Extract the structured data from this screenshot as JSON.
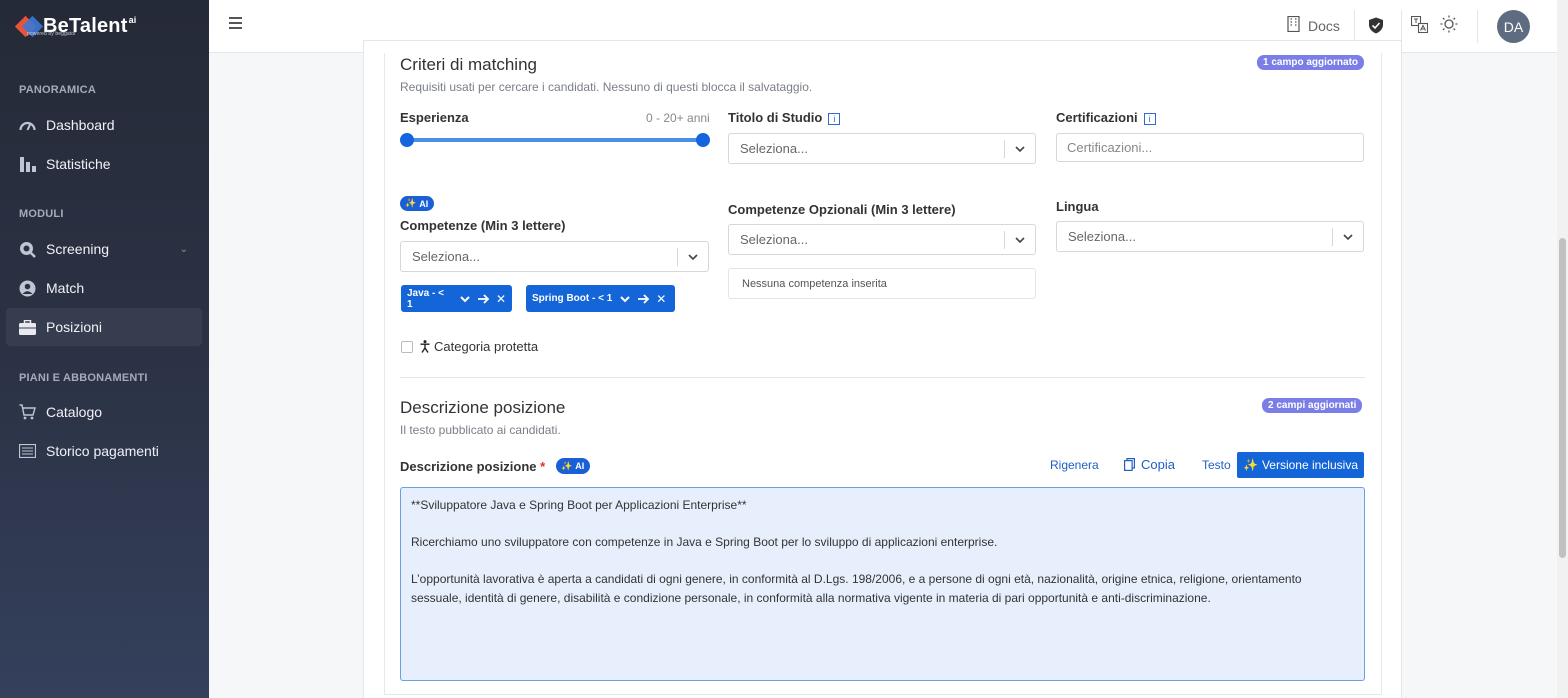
{
  "sidebar": {
    "brand": "BeTalent",
    "brand_suffix": "ai",
    "brand_tagline": "powered by beggator",
    "sections": [
      {
        "title": "PANORAMICA",
        "items": [
          {
            "label": "Dashboard",
            "icon": "gauge-icon"
          },
          {
            "label": "Statistiche",
            "icon": "bar-chart-icon"
          }
        ]
      },
      {
        "title": "MODULI",
        "items": [
          {
            "label": "Screening",
            "icon": "search-icon"
          },
          {
            "label": "Match",
            "icon": "user-circle-icon"
          },
          {
            "label": "Posizioni",
            "icon": "briefcase-icon",
            "active": true
          }
        ]
      },
      {
        "title": "PIANI E ABBONAMENTI",
        "items": [
          {
            "label": "Catalogo",
            "icon": "cart-icon"
          },
          {
            "label": "Storico pagamenti",
            "icon": "list-icon"
          }
        ]
      }
    ]
  },
  "header": {
    "docs_label": "Docs",
    "avatar_initials": "DA"
  },
  "matching": {
    "title": "Criteri di matching",
    "subtitle": "Requisiti usati per cercare i candidati. Nessuno di questi blocca il salvataggio.",
    "badge": "1 campo aggiornato",
    "experience": {
      "label": "Esperienza",
      "range_text": "0 - 20+ anni",
      "min": 0,
      "max": 20
    },
    "titolo_studio": {
      "label": "Titolo di Studio",
      "placeholder": "Seleziona..."
    },
    "certificazioni": {
      "label": "Certificazioni",
      "placeholder": "Certificazioni..."
    },
    "ai_badge": "AI",
    "competenze": {
      "label": "Competenze (Min 3 lettere)",
      "placeholder": "Seleziona...",
      "chips": [
        "Java - < 1",
        "Spring Boot - < 1"
      ]
    },
    "competenze_opzionali": {
      "label": "Competenze Opzionali (Min 3 lettere)",
      "placeholder": "Seleziona...",
      "empty_text": "Nessuna competenza inserita"
    },
    "lingua": {
      "label": "Lingua",
      "placeholder": "Seleziona..."
    },
    "categoria_protetta": "Categoria protetta"
  },
  "descrizione": {
    "title": "Descrizione posizione",
    "subtitle": "Il testo pubblicato ai candidati.",
    "badge": "2 campi aggiornati",
    "field_label": "Descrizione posizione",
    "required_mark": "*",
    "ai_badge": "AI",
    "actions": {
      "rigenera": "Rigenera",
      "copia": "Copia",
      "testo": "Testo",
      "versione_inclusiva": "Versione inclusiva"
    },
    "text": {
      "p1": "**Sviluppatore Java e Spring Boot per Applicazioni Enterprise**",
      "p2": "Ricerchiamo uno sviluppatore con competenze in Java e Spring Boot per lo sviluppo di applicazioni enterprise.",
      "p3": "L’opportunità lavorativa è aperta a candidati di ogni genere, in conformità al D.Lgs. 198/2006, e a persone di ogni età, nazionalità, origine etnica, religione, orientamento sessuale, identità di genere, disabilità e condizione personale, in conformità alla normativa vigente in materia di pari opportunità e anti-discriminazione."
    }
  }
}
